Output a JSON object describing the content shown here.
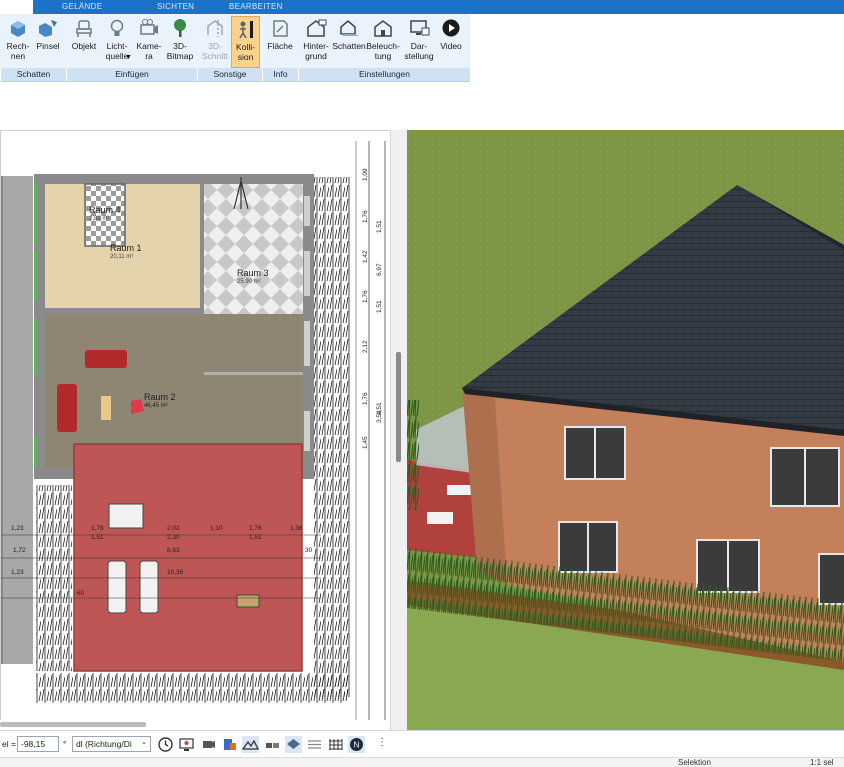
{
  "ribbon": {
    "tabs": [
      "GELÄNDE",
      "SICHTEN",
      "BEARBEITEN"
    ],
    "buttons": {
      "rechnen": "Rech-\nnen",
      "pinsel": "Pinsel",
      "objekt": "Objekt",
      "lichtquelle": "Licht-\nquelle",
      "kamera": "Kame-\nra",
      "bitmap": "3D-\nBitmap",
      "schnitt": "3D-\nSchnitt",
      "kollision": "Kolli-\nsion",
      "flaeche": "Fläche",
      "hintergrund": "Hinter-\ngrund",
      "schatten": "Schatten",
      "beleuchtung": "Beleuch-\ntung",
      "darstellung": "Dar-\nstellung",
      "video": "Video"
    },
    "groups": {
      "schatten": "Schatten",
      "einfuegen": "Einfügen",
      "sonstige": "Sonstige",
      "info": "Info",
      "einstellungen": "Einstellungen"
    }
  },
  "plan": {
    "rooms": [
      {
        "name": "Raum 4",
        "area": "2,88 m²"
      },
      {
        "name": "Raum 1",
        "area": "20,11 m²"
      },
      {
        "name": "Raum 3",
        "area": "25,90 m²"
      },
      {
        "name": "Raum 2",
        "area": "46,45 m²"
      }
    ],
    "dims_right": [
      "1,09",
      "1,76",
      "1,51",
      "1,42",
      "6,97",
      "1,76",
      "1,51",
      "2,12",
      "1,76",
      "1,51",
      "3,54",
      "1,45"
    ],
    "dims_bottom_row1": [
      "1,23",
      "1,78",
      "2,02",
      "1,10",
      "1,76",
      "1,36"
    ],
    "dims_bottom_row1b": [
      "1,51",
      "2,30",
      "1,51"
    ],
    "dims_bottom_row2": [
      "1,72",
      "8,63",
      "30"
    ],
    "dims_bottom_row3": [
      "1,23",
      "10,36"
    ],
    "dims_bottom_row4": [
      "60"
    ]
  },
  "bottombar": {
    "winkel_label": "el =",
    "winkel_value": "-98,15",
    "degree": "°",
    "richtung_value": "dl (Richtung/Di"
  },
  "status": {
    "mode": "Selektion",
    "selection": "1:1 sel"
  },
  "colors": {
    "ribbon_tab": "#1a73c8",
    "ribbon_bg": "#eaf2fb",
    "active_button": "#f9d38b",
    "roof": "#2f353c",
    "wall": "#c4805a",
    "lawn": "#7f9a48",
    "terrace": "#b53d3d"
  }
}
